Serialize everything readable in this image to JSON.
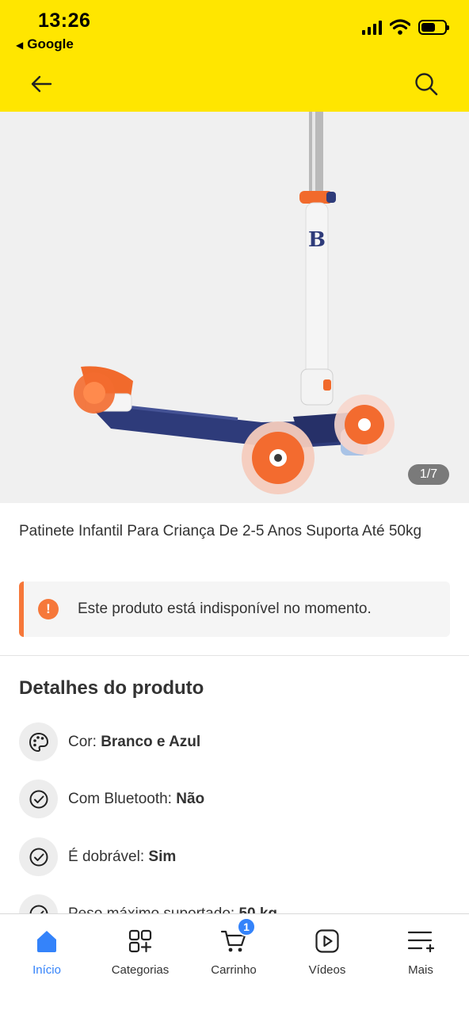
{
  "status_bar": {
    "time": "13:26",
    "back_app": "Google"
  },
  "header": {
    "background": "#FFE600",
    "back_icon": "arrow-left-icon",
    "search_icon": "search-icon"
  },
  "gallery": {
    "counter": "1/7",
    "image": "kids-scooter-white-blue-orange"
  },
  "product": {
    "title": "Patinete Infantil Para Criança De 2-5 Anos Suporta Até 50kg"
  },
  "alert": {
    "icon": "!",
    "text": "Este produto está indisponível no momento.",
    "accent": "#f6783a"
  },
  "details": {
    "heading": "Detalhes do produto",
    "items": [
      {
        "icon": "palette-icon",
        "label": "Cor:",
        "value": "Branco e Azul"
      },
      {
        "icon": "check-circle-icon",
        "label": "Com Bluetooth:",
        "value": "Não"
      },
      {
        "icon": "check-circle-icon",
        "label": "É dobrável:",
        "value": "Sim"
      },
      {
        "icon": "check-circle-icon",
        "label": "Peso máximo suportado:",
        "value": "50 kg"
      }
    ]
  },
  "bottom_nav": {
    "items": [
      {
        "label": "Início",
        "icon": "home-icon",
        "active": true
      },
      {
        "label": "Categorias",
        "icon": "categories-icon"
      },
      {
        "label": "Carrinho",
        "icon": "cart-icon",
        "badge": "1"
      },
      {
        "label": "Vídeos",
        "icon": "video-play-icon"
      },
      {
        "label": "Mais",
        "icon": "menu-more-icon"
      }
    ],
    "active_color": "#3483fa"
  }
}
